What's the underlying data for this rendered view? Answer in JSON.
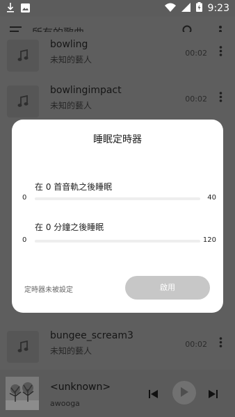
{
  "status_bar": {
    "time": "9:23",
    "icons": [
      "download-icon",
      "image-icon",
      "wifi-icon",
      "signal-icon",
      "battery-charging-icon"
    ]
  },
  "app_bar": {
    "title": "所有的歌曲",
    "icons": [
      "menu-icon",
      "search-icon",
      "more-vert-icon"
    ]
  },
  "songs": [
    {
      "title": "bowling",
      "artist": "未知的藝人",
      "duration": "00:02"
    },
    {
      "title": "bowlingimpact",
      "artist": "未知的藝人",
      "duration": "00:02"
    },
    {
      "title": "bungee_scream3",
      "artist": "未知的藝人",
      "duration": "00:02"
    }
  ],
  "player": {
    "title": "<unknown>",
    "artist": "awooga",
    "icons": [
      "skip-previous-icon",
      "play-icon",
      "skip-next-icon"
    ]
  },
  "sleep_timer": {
    "title": "睡眠定時器",
    "tracks": {
      "label": "在 0 首音軌之後睡眠",
      "min_label": "0",
      "max_label": "40",
      "value": 0
    },
    "minutes": {
      "label": "在 0 分鐘之後睡眠",
      "min_label": "0",
      "max_label": "120",
      "value": 0
    },
    "status": "定時器未被設定",
    "enable_label": "啟用"
  },
  "colors": {
    "dialog_bg": "#ffffff",
    "scrim": "#5e5e5e",
    "button_disabled": "#c7c7c7"
  }
}
